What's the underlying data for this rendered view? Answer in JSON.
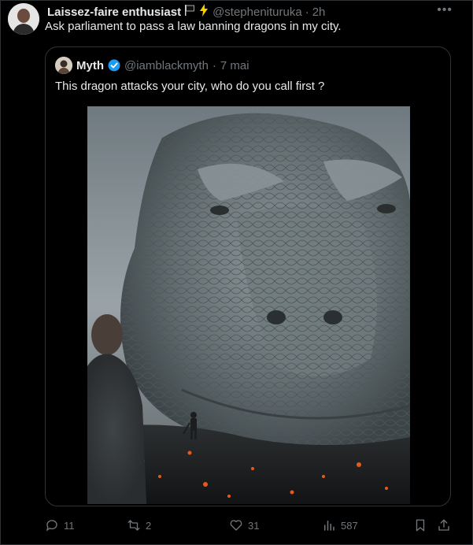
{
  "post": {
    "author_name": "Laissez-faire enthusiast",
    "author_handle": "@stepheniturukа",
    "time": "2h",
    "separator": "·",
    "text": "Ask parliament to pass a law banning dragons in my city."
  },
  "quoted": {
    "author_name": "Myth",
    "author_handle": "@iamblackmyth",
    "time": "7 mai",
    "separator": "·",
    "text": "This dragon attacks your city, who do you call first ?"
  },
  "actions": {
    "replies": "11",
    "reposts": "2",
    "likes": "31",
    "views": "587"
  },
  "colors": {
    "background": "#000000",
    "text": "#e7e9ea",
    "muted": "#71767b",
    "border": "#2f3336",
    "verified": "#1d9bf0",
    "bolt": "#ffcc00"
  }
}
